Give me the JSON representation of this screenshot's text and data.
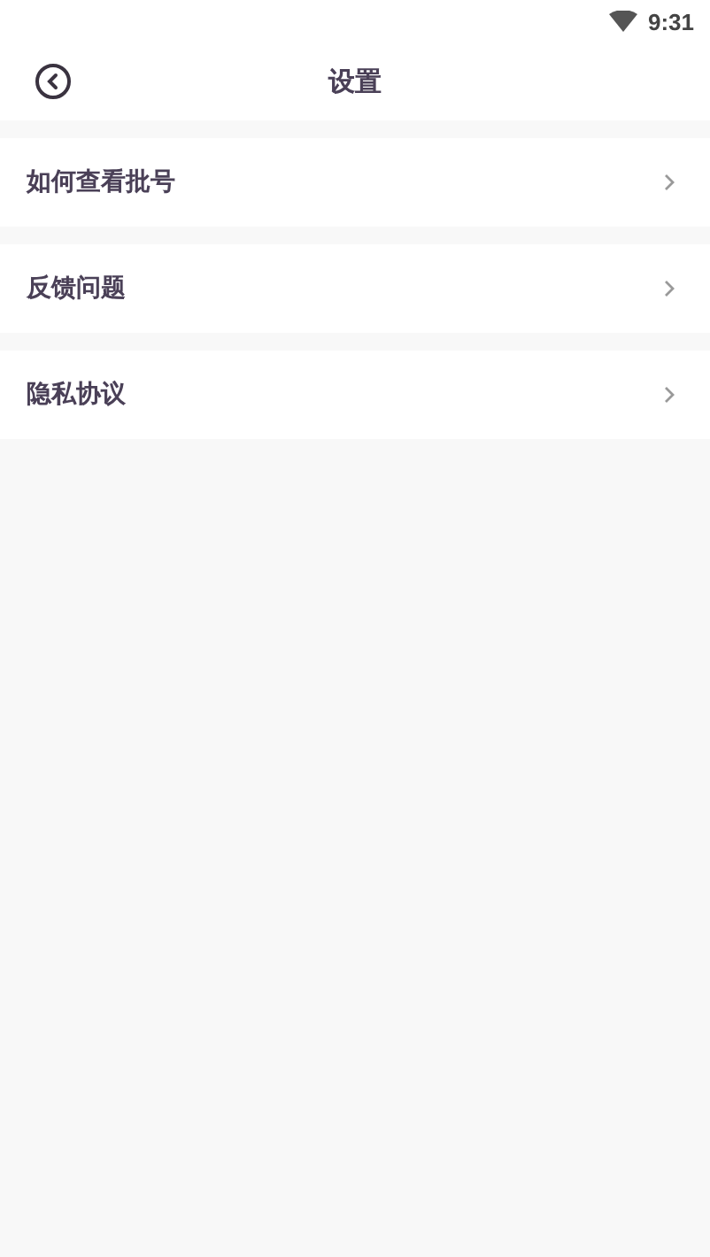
{
  "status_bar": {
    "time": "9:31"
  },
  "header": {
    "title": "设置"
  },
  "items": [
    {
      "label": "如何查看批号"
    },
    {
      "label": "反馈问题"
    },
    {
      "label": "隐私协议"
    }
  ]
}
